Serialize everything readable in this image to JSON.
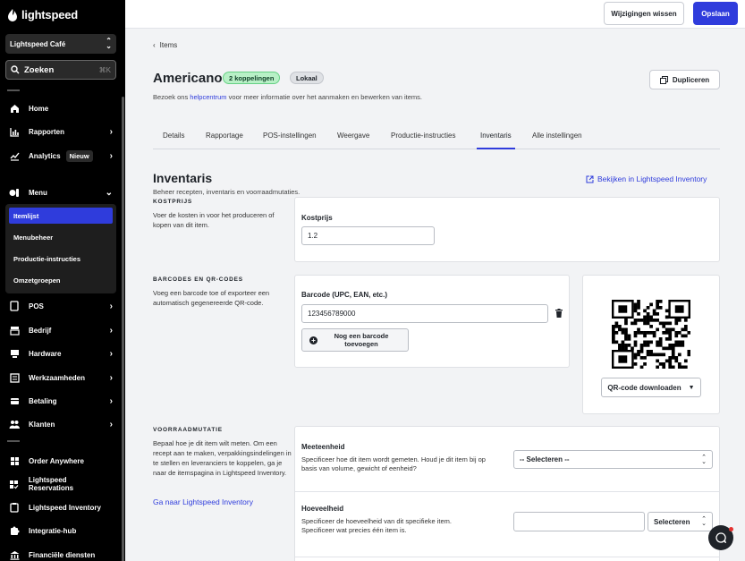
{
  "app": {
    "brand": "lightspeed"
  },
  "sidebar": {
    "location": "Lightspeed Café",
    "search": {
      "label": "Zoeken",
      "shortcut": "⌘K"
    },
    "items": [
      {
        "label": "Home",
        "icon": "home-icon"
      },
      {
        "label": "Rapporten",
        "icon": "bar-chart-icon"
      },
      {
        "label": "Analytics",
        "icon": "trend-icon",
        "badge": "Nieuw"
      },
      {
        "label": "Menu",
        "icon": "menu-book-icon"
      },
      {
        "label": "POS",
        "icon": "tablet-icon"
      },
      {
        "label": "Bedrijf",
        "icon": "store-icon"
      },
      {
        "label": "Hardware",
        "icon": "hardware-icon"
      },
      {
        "label": "Werkzaamheden",
        "icon": "tasks-icon"
      },
      {
        "label": "Betaling",
        "icon": "payment-icon"
      },
      {
        "label": "Klanten",
        "icon": "users-icon"
      },
      {
        "label": "Order Anywhere",
        "icon": "grid-icon"
      },
      {
        "label": "Lightspeed Reservations",
        "icon": "grid-check-icon"
      },
      {
        "label": "Lightspeed Inventory",
        "icon": "clipboard-icon"
      },
      {
        "label": "Integratie-hub",
        "icon": "puzzle-icon"
      },
      {
        "label": "Financiële diensten",
        "icon": "bank-icon"
      }
    ],
    "menu_sub": [
      "Itemlijst",
      "Menubeheer",
      "Productie-instructies",
      "Omzetgroepen"
    ]
  },
  "topbar": {
    "discard_label": "Wijzigingen wissen",
    "save_label": "Opslaan"
  },
  "page": {
    "breadcrumb": "Items",
    "title": "Americano",
    "pill_links": "2 koppelingen",
    "pill_local": "Lokaal",
    "duplicate_label": "Dupliceren",
    "help_prefix": "Bezoek ons ",
    "help_link": "helpcentrum",
    "help_suffix": " voor meer informatie over het aanmaken en bewerken van items."
  },
  "tabs": [
    "Details",
    "Rapportage",
    "POS-instellingen",
    "Weergave",
    "Productie-instructies",
    "Inventaris",
    "Alle instellingen"
  ],
  "active_tab": "Inventaris",
  "inventory": {
    "title": "Inventaris",
    "subtitle": "Beheer recepten, inventaris en voorraadmutaties.",
    "view_link": "Bekijken in Lightspeed Inventory",
    "cost": {
      "group": "KOSTPRIJS",
      "desc": "Voer de kosten in voor het produceren of kopen van dit item.",
      "label": "Kostprijs",
      "value": "1.2"
    },
    "barcodes": {
      "group": "BARCODES EN QR-CODES",
      "desc": "Voeg een barcode toe of exporteer een automatisch gegenereerde QR-code.",
      "label": "Barcode (UPC, EAN, etc.)",
      "value": "123456789000",
      "add_label": "Nog een barcode toevoegen",
      "qr_download": "QR-code downloaden"
    },
    "stock": {
      "group": "VOORRAADMUTATIE",
      "desc": "Bepaal hoe je dit item wilt meten. Om een recept aan te maken, verpakkingsindelingen in te stellen en leveranciers te koppelen, ga je naar de itemspagina in Lightspeed Inventory.",
      "link": "Ga naar Lightspeed Inventory",
      "unit_label": "Meeteenheid",
      "unit_hint": "Specificeer hoe dit item wordt gemeten. Houd je dit item bij op basis van volume, gewicht of eenheid?",
      "unit_select": "-- Selecteren --",
      "qty_label": "Hoeveelheid",
      "qty_hint": "Specificeer de hoeveelheid van dit specifieke item. Specificeer wat precies één item is.",
      "qty_value": "",
      "qty_select": "Selecteren"
    }
  },
  "colors": {
    "accent": "#2f3cdc",
    "sidebar": "#000000",
    "pill_green": "#b8f0c6"
  }
}
